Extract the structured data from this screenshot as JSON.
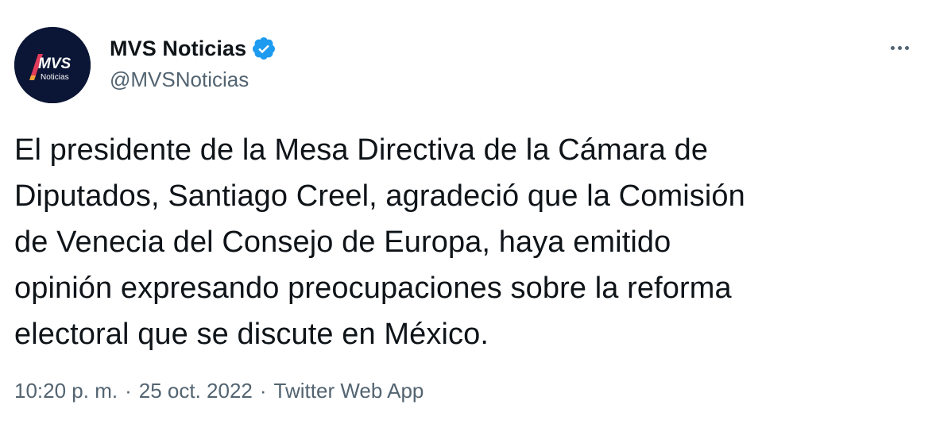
{
  "author": {
    "display_name": "MVS Noticias",
    "handle": "@MVSNoticias",
    "verified": true,
    "avatar_text": "MVS",
    "avatar_subtext": "Noticias"
  },
  "tweet": {
    "text": "El presidente de la Mesa Directiva de la Cámara de\nDiputados, Santiago Creel, agradeció que la Comisión\nde Venecia del Consejo de Europa, haya emitido\nopinión expresando preocupaciones sobre la reforma\nelectoral que se discute en México."
  },
  "meta": {
    "time": "10:20 p. m.",
    "separator": "·",
    "date": "25 oct. 2022",
    "source": "Twitter Web App"
  },
  "icons": {
    "verified": "verified-badge-icon",
    "more": "more-options-icon"
  },
  "colors": {
    "text": "#0f1419",
    "secondary": "#536471",
    "verified": "#1d9bf0",
    "avatar_bg": "#0b1636"
  }
}
